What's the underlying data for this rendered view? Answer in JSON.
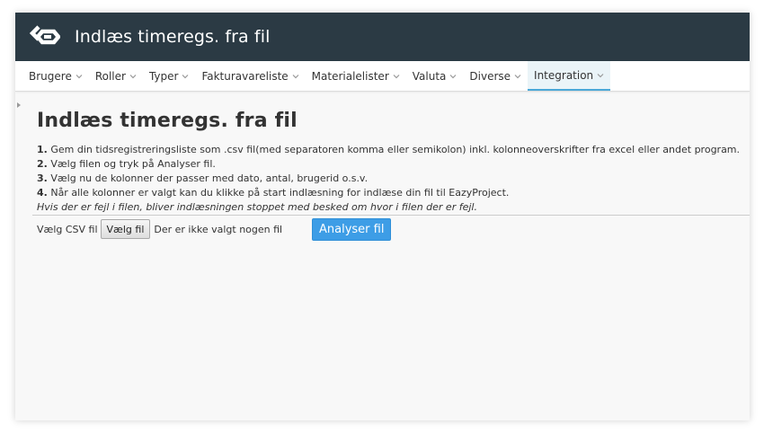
{
  "app": {
    "title": "Indlæs timeregs. fra fil",
    "logo_icon": "eazyproject-logo-icon"
  },
  "colors": {
    "titlebar_bg": "#2b3a44",
    "active_tab_bg": "#eaf4f8",
    "active_tab_accent": "#4aa8d8",
    "primary_button": "#3d9de6"
  },
  "navbar": {
    "items": [
      {
        "label": "Brugere",
        "active": false
      },
      {
        "label": "Roller",
        "active": false
      },
      {
        "label": "Typer",
        "active": false
      },
      {
        "label": "Fakturavareliste",
        "active": false
      },
      {
        "label": "Materialelister",
        "active": false
      },
      {
        "label": "Valuta",
        "active": false
      },
      {
        "label": "Diverse",
        "active": false
      },
      {
        "label": "Integration",
        "active": true
      }
    ],
    "dropdown_icon": "chevron-down-icon"
  },
  "main": {
    "heading": "Indlæs timeregs. fra fil",
    "steps": [
      {
        "num": "1.",
        "text": " Gem din tidsregistreringsliste som .csv fil(med separatoren komma eller semikolon) inkl. kolonneoverskrifter fra excel eller andet program."
      },
      {
        "num": "2.",
        "text": " Vælg filen og tryk på Analyser fil."
      },
      {
        "num": "3.",
        "text": " Vælg nu de kolonner der passer med dato, antal, brugerid o.s.v."
      },
      {
        "num": "4.",
        "text": " Når alle kolonner er valgt kan du klikke på start indlæsning for indlæse din fil til EazyProject."
      }
    ],
    "note": "Hvis der er fejl i filen, bliver indlæsningen stoppet med besked om hvor i filen der er fejl.",
    "file": {
      "label": "Vælg CSV fil",
      "button_label": "Vælg fil",
      "status": "Der er ikke valgt nogen fil"
    },
    "analyse_button": "Analyser fil"
  }
}
